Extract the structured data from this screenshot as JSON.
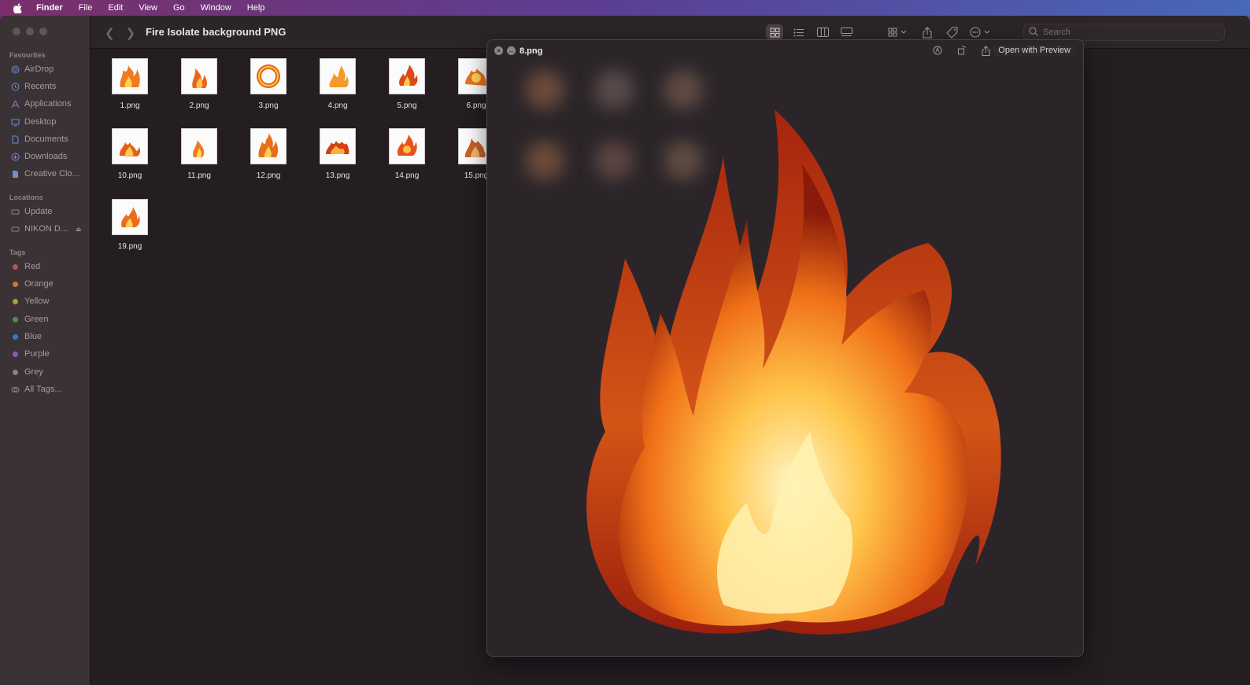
{
  "menubar": {
    "app_name": "Finder",
    "items": [
      "File",
      "Edit",
      "View",
      "Go",
      "Window",
      "Help"
    ]
  },
  "window": {
    "title": "Fire Isolate background PNG"
  },
  "sidebar": {
    "favourites_header": "Favourites",
    "favourites": [
      {
        "label": "AirDrop",
        "icon": "airdrop-icon"
      },
      {
        "label": "Recents",
        "icon": "clock-icon"
      },
      {
        "label": "Applications",
        "icon": "applications-icon"
      },
      {
        "label": "Desktop",
        "icon": "desktop-icon"
      },
      {
        "label": "Documents",
        "icon": "document-icon"
      },
      {
        "label": "Downloads",
        "icon": "downloads-icon"
      },
      {
        "label": "Creative Clo...",
        "icon": "file-icon"
      }
    ],
    "locations_header": "Locations",
    "locations": [
      {
        "label": "Update",
        "icon": "drive-icon"
      },
      {
        "label": "NIKON D...",
        "icon": "drive-icon"
      }
    ],
    "tags_header": "Tags",
    "tags": [
      {
        "label": "Red",
        "color": "#c0504d"
      },
      {
        "label": "Orange",
        "color": "#c27c2e"
      },
      {
        "label": "Yellow",
        "color": "#b59b2c"
      },
      {
        "label": "Green",
        "color": "#3f9a3f"
      },
      {
        "label": "Blue",
        "color": "#3f74c4"
      },
      {
        "label": "Purple",
        "color": "#9456b8"
      },
      {
        "label": "Grey",
        "color": "#8a8386"
      }
    ],
    "all_tags": "All Tags..."
  },
  "toolbar": {
    "search_placeholder": "Search"
  },
  "files": [
    "1.png",
    "2.png",
    "3.png",
    "4.png",
    "5.png",
    "6.png",
    "10.png",
    "11.png",
    "12.png",
    "13.png",
    "14.png",
    "15.png",
    "19.png"
  ],
  "quicklook": {
    "filename": "8.png",
    "open_with": "Open with Preview"
  }
}
